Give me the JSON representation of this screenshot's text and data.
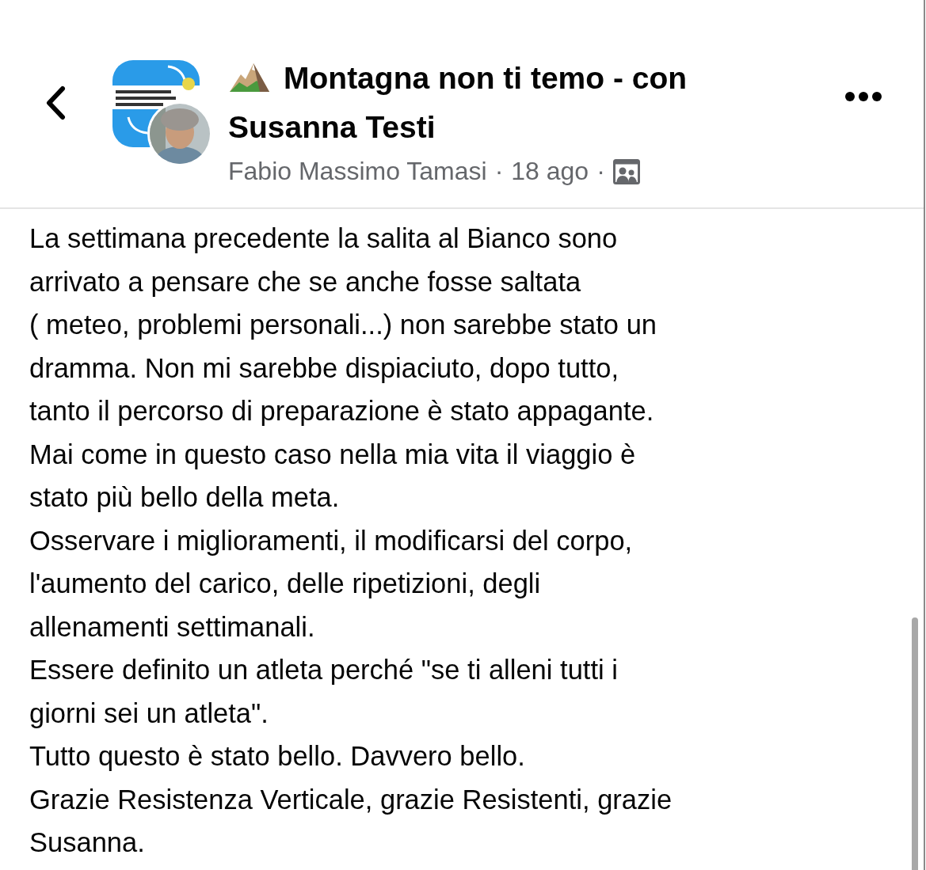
{
  "header": {
    "title_lines": [
      "Montagna non ti temo - con",
      "Susanna Testi"
    ],
    "author": "Fabio Massimo Tamasi",
    "separator_1": "·",
    "time": "18 ago",
    "separator_2": "·"
  },
  "post": {
    "paragraphs": [
      [
        "La settimana precedente la salita al Bianco sono",
        "arrivato a pensare che se anche fosse saltata",
        "( meteo, problemi personali...) non sarebbe stato un",
        "dramma. Non mi sarebbe dispiaciuto, dopo tutto,",
        "tanto il percorso di preparazione è stato appagante."
      ],
      [
        "Mai come in questo caso nella mia vita il viaggio è",
        "stato più bello della meta."
      ],
      [
        "Osservare i miglioramenti, il modificarsi del corpo,",
        "l'aumento del carico, delle ripetizioni, degli",
        "allenamenti settimanali."
      ],
      [
        "Essere definito un atleta perché \"se ti alleni tutti i",
        "giorni sei un atleta\"."
      ],
      [
        "Tutto questo è stato bello. Davvero bello."
      ],
      [
        "Grazie Resistenza Verticale, grazie Resistenti, grazie",
        "Susanna."
      ]
    ]
  }
}
